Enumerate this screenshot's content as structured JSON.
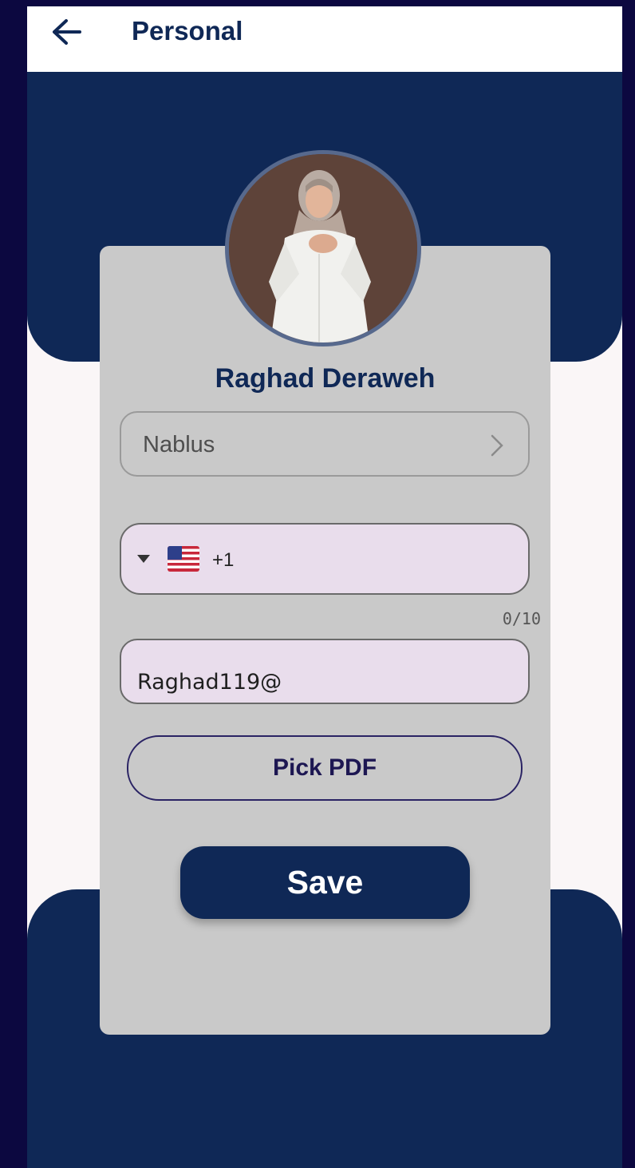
{
  "appbar": {
    "title": "Personal",
    "back_icon": "arrow-left-icon"
  },
  "profile": {
    "name": "Raghad Deraweh",
    "avatar_alt": "profile photo"
  },
  "form": {
    "city_value": "Nablus",
    "phone": {
      "country_flag": "us-flag-icon",
      "dial_code": "+1",
      "value": "",
      "counter": "0/10"
    },
    "email": {
      "value": "Raghad119@"
    },
    "pick_pdf_label": "Pick PDF",
    "save_label": "Save"
  },
  "colors": {
    "navy": "#0f2856",
    "card": "#c9c9c9",
    "field_fill": "#e9ddec",
    "background": "#faf6f7",
    "outer": "#0c0840"
  }
}
